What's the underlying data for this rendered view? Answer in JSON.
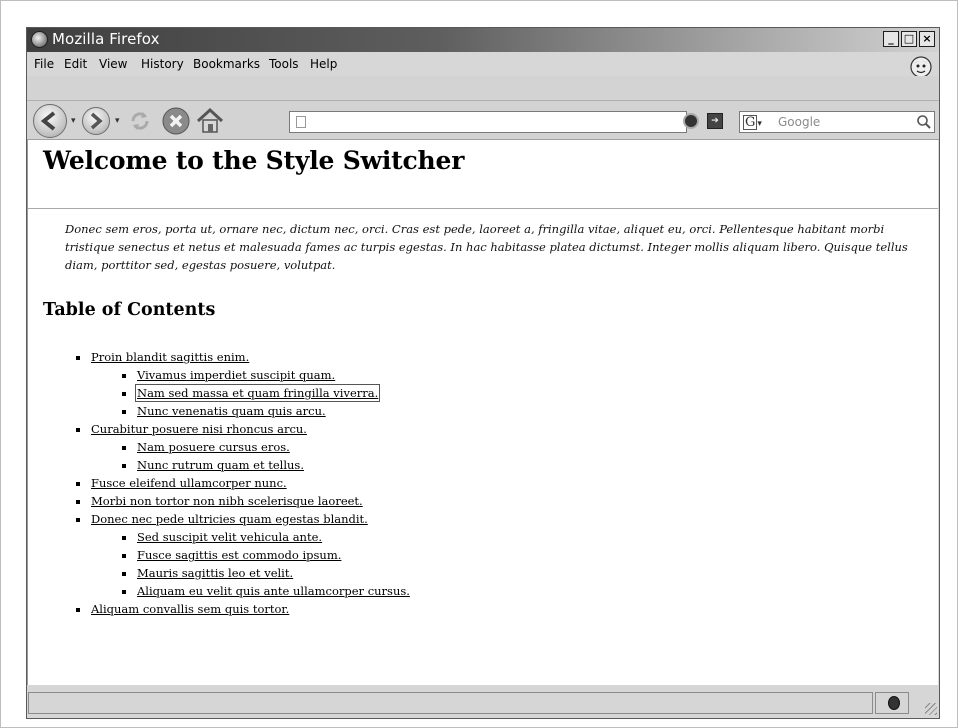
{
  "window": {
    "title": "Mozilla Firefox",
    "controls": {
      "minimize": "_",
      "maximize": "□",
      "close": "×"
    }
  },
  "menu": {
    "items": [
      {
        "label": "File",
        "key": "F"
      },
      {
        "label": "Edit",
        "key": "E"
      },
      {
        "label": "View",
        "key": "V"
      },
      {
        "label": "History",
        "key": "s"
      },
      {
        "label": "Bookmarks",
        "key": "B"
      },
      {
        "label": "Tools",
        "key": "T"
      },
      {
        "label": "Help",
        "key": "H"
      }
    ]
  },
  "toolbar": {
    "icons": [
      "back-icon",
      "forward-icon",
      "reload-icon",
      "stop-icon",
      "home-icon"
    ],
    "url_value": "",
    "search_engine": "G",
    "search_placeholder": "Google"
  },
  "page": {
    "title": "Welcome to the Style Switcher",
    "intro": "Donec sem eros, porta ut, ornare nec, dictum nec, orci. Cras est pede, laoreet a, fringilla vitae, aliquet eu, orci. Pellentesque habitant morbi tristique senectus et netus et malesuada fames ac turpis egestas. In hac habitasse platea dictumst. Integer mollis aliquam libero. Quisque tellus diam, porttitor sed, egestas posuere, volutpat.",
    "toc_title": "Table of Contents",
    "toc": [
      {
        "level": 1,
        "text": "Proin blandit sagittis enim."
      },
      {
        "level": 2,
        "text": "Vivamus imperdiet suscipit quam."
      },
      {
        "level": 2,
        "text": "Nam sed massa et quam fringilla viverra.",
        "focused": true
      },
      {
        "level": 2,
        "text": "Nunc venenatis quam quis arcu."
      },
      {
        "level": 1,
        "text": "Curabitur posuere nisi rhoncus arcu."
      },
      {
        "level": 2,
        "text": "Nam posuere cursus eros."
      },
      {
        "level": 2,
        "text": "Nunc rutrum quam et tellus."
      },
      {
        "level": 1,
        "text": "Fusce eleifend ullamcorper nunc."
      },
      {
        "level": 1,
        "text": "Morbi non tortor non nibh scelerisque laoreet."
      },
      {
        "level": 1,
        "text": "Donec nec pede ultricies quam egestas blandit."
      },
      {
        "level": 2,
        "text": "Sed suscipit velit vehicula ante."
      },
      {
        "level": 2,
        "text": "Fusce sagittis est commodo ipsum."
      },
      {
        "level": 2,
        "text": "Mauris sagittis leo et velit."
      },
      {
        "level": 2,
        "text": "Aliquam eu velit quis ante ullamcorper cursus."
      },
      {
        "level": 1,
        "text": "Aliquam convallis sem quis tortor."
      }
    ]
  },
  "status": {
    "text": ""
  },
  "colors": {
    "titlebar_dark": "#3f3f3f",
    "chrome": "#d7d7d7",
    "content_bg": "#ffffff"
  }
}
